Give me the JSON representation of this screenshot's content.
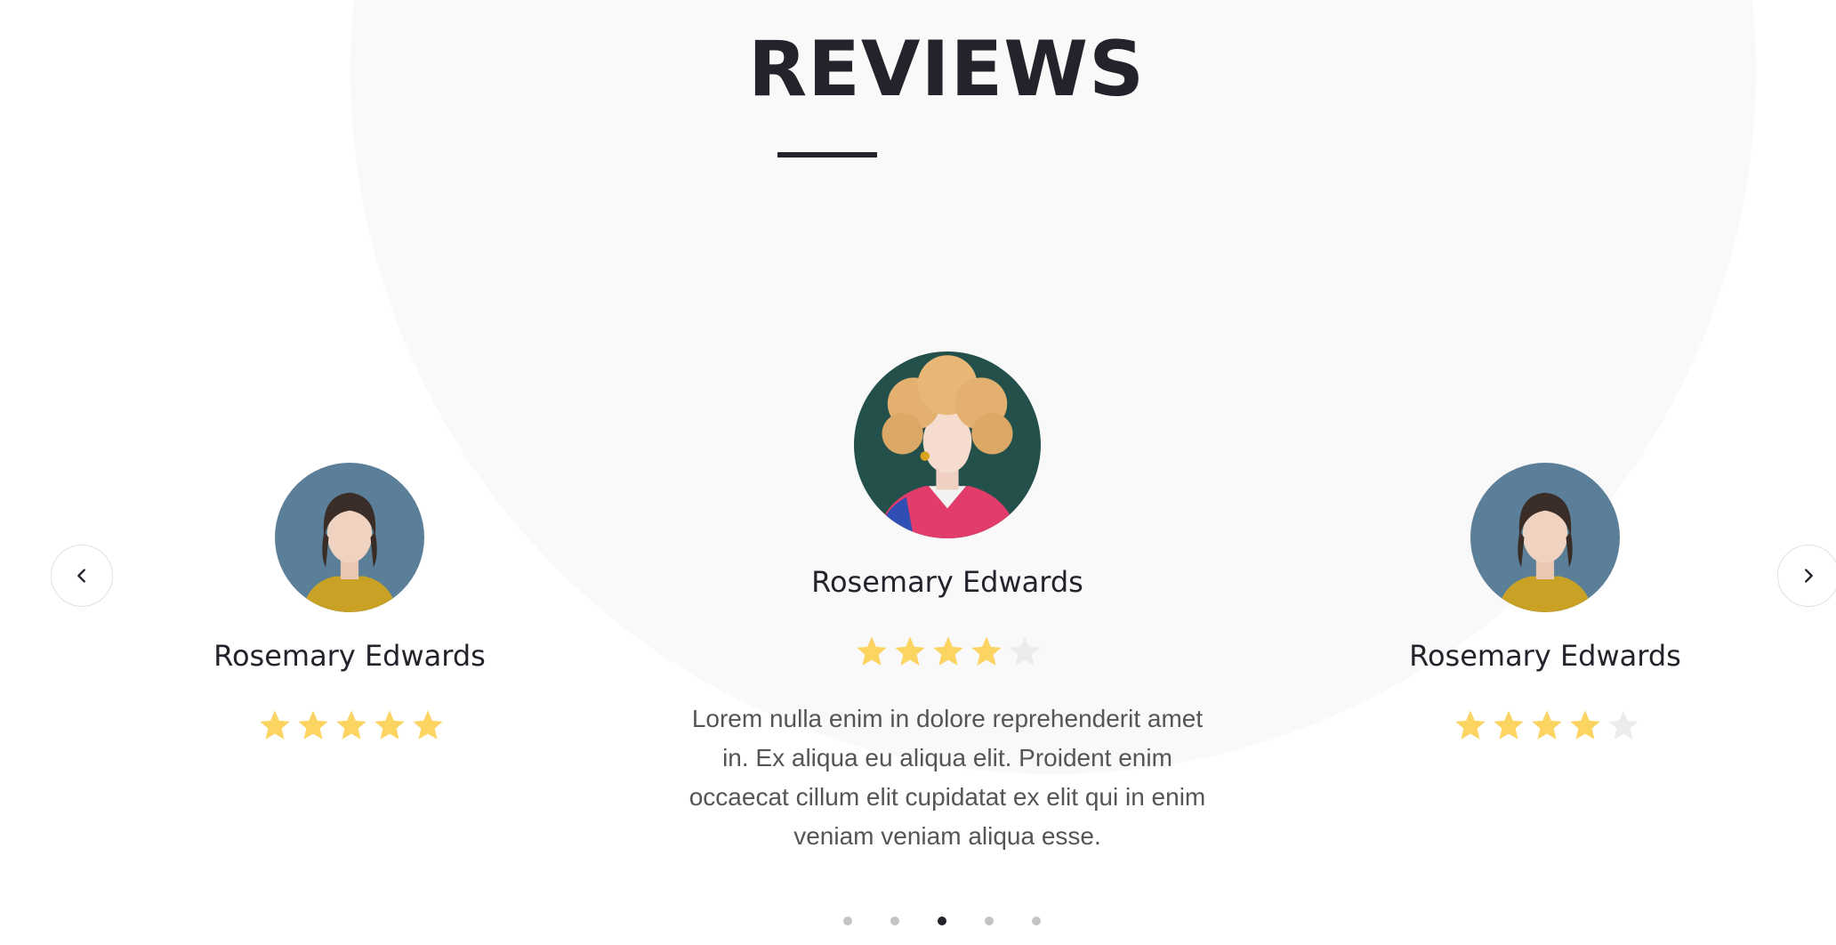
{
  "section": {
    "title": "REVIEWS"
  },
  "reviews": [
    {
      "name": "Rosemary Edwards",
      "rating": 5,
      "avatar_icon": "woman-portrait-icon"
    },
    {
      "name": "Rosemary Edwards",
      "rating": 4,
      "avatar_icon": "person-curly-hair-portrait-icon",
      "text": "Lorem nulla enim in dolore reprehenderit amet in. Ex aliqua eu aliqua elit. Proident enim occaecat cillum elit cupidatat ex elit qui in enim veniam veniam aliqua esse."
    },
    {
      "name": "Rosemary Edwards",
      "rating": 4,
      "avatar_icon": "woman-portrait-icon"
    }
  ],
  "carousel": {
    "prev_icon": "chevron-left-icon",
    "next_icon": "chevron-right-icon",
    "dot_count": 5,
    "active_dot": 3
  },
  "colors": {
    "heading": "#24232b",
    "star_filled": "#fcd462",
    "star_empty": "#ececec",
    "background_circle": "#f9f9f9"
  }
}
